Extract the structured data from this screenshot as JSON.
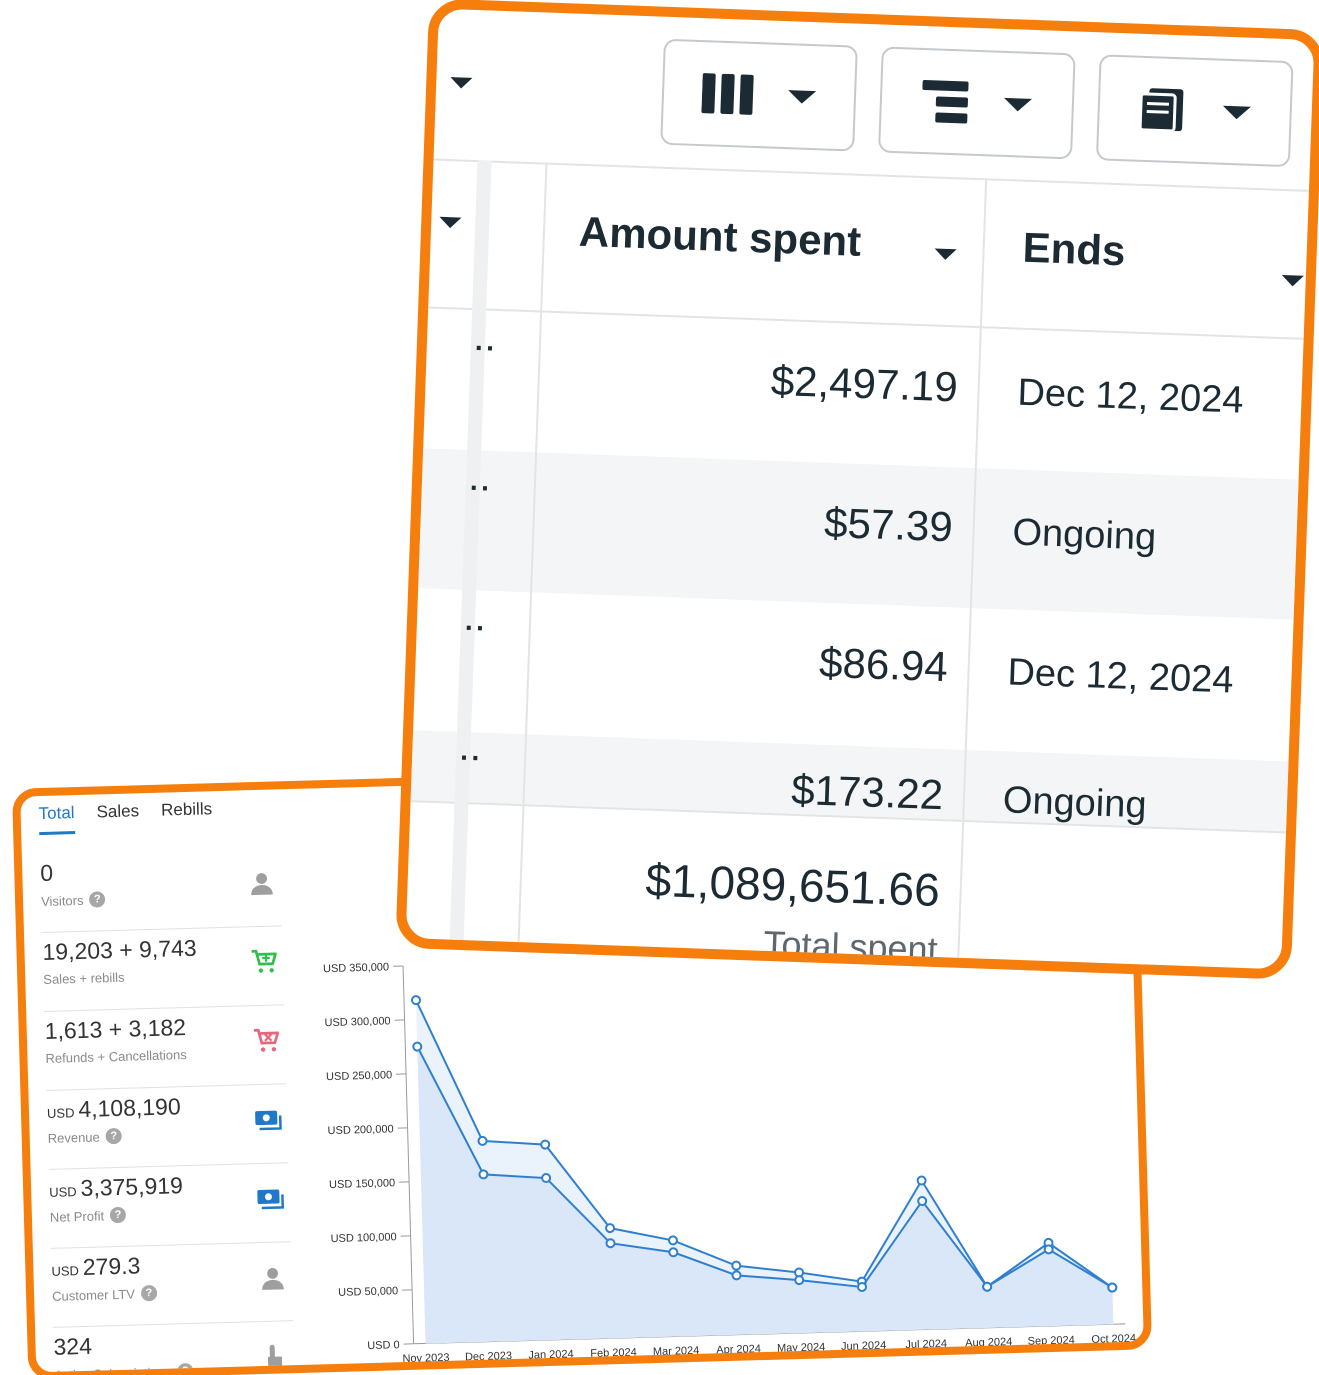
{
  "dashboard": {
    "tabs": [
      {
        "label": "Total",
        "active": true
      },
      {
        "label": "Sales",
        "active": false
      },
      {
        "label": "Rebills",
        "active": false
      }
    ],
    "stats": [
      {
        "value": "0",
        "unit": "",
        "label": "Visitors",
        "help": true,
        "icon": "user-icon",
        "icon_color": "#9e9e9e"
      },
      {
        "value": "19,203 + 9,743",
        "unit": "",
        "label": "Sales + rebills",
        "help": false,
        "icon": "cart-add-icon",
        "icon_color": "#2fbf4a"
      },
      {
        "value": "1,613 + 3,182",
        "unit": "",
        "label": "Refunds + Cancellations",
        "help": false,
        "icon": "cart-remove-icon",
        "icon_color": "#e8667a"
      },
      {
        "value": "4,108,190",
        "unit": "USD",
        "label": "Revenue",
        "help": true,
        "icon": "money-icon",
        "icon_color": "#1f78c8"
      },
      {
        "value": "3,375,919",
        "unit": "USD",
        "label": "Net Profit",
        "help": true,
        "icon": "money-icon",
        "icon_color": "#1f78c8"
      },
      {
        "value": "279.3",
        "unit": "USD",
        "label": "Customer LTV",
        "help": true,
        "icon": "user-icon",
        "icon_color": "#9e9e9e"
      },
      {
        "value": "324",
        "unit": "",
        "label": "Active Subscriptions",
        "help": true,
        "icon": "tap-icon",
        "icon_color": "#9e9e9e"
      }
    ],
    "help_glyph": "?"
  },
  "chart_data": {
    "type": "area",
    "x": [
      "Nov 2023",
      "Dec 2023",
      "Jan 2024",
      "Feb 2024",
      "Mar 2024",
      "Apr 2024",
      "May 2024",
      "Jun 2024",
      "Jul 2024",
      "Aug 2024",
      "Sep 2024",
      "Oct 2024"
    ],
    "series": [
      {
        "values": [
          318000,
          186000,
          181000,
          102000,
          89000,
          64000,
          56000,
          46000,
          138000,
          38000,
          77000,
          34000
        ],
        "color": "#2f7fd1",
        "fill": "#eaf2fb"
      },
      {
        "values": [
          275000,
          155000,
          150000,
          88000,
          78000,
          55000,
          49000,
          41000,
          119000,
          38000,
          71000,
          34000
        ],
        "color": "#2f7fd1",
        "fill": "#d9e7f8"
      }
    ],
    "yticks": [
      "USD 0",
      "USD 50,000",
      "USD 100,000",
      "USD 150,000",
      "USD 200,000",
      "USD 250,000",
      "USD 300,000",
      "USD 350,000"
    ],
    "ylim": [
      0,
      350000
    ],
    "grid": false,
    "markers": true
  },
  "ads_table": {
    "columns": [
      {
        "label": "Amount spent"
      },
      {
        "label": "Ends"
      }
    ],
    "rows": [
      {
        "amount": "$2,497.19",
        "ends": "Dec 12, 2024",
        "shaded": false
      },
      {
        "amount": "$57.39",
        "ends": "Ongoing",
        "shaded": true
      },
      {
        "amount": "$86.94",
        "ends": "Dec 12, 2024",
        "shaded": false
      },
      {
        "amount": "$173.22",
        "ends": "Ongoing",
        "shaded": true
      }
    ],
    "row_menu_glyph": "··",
    "total": {
      "value": "$1,089,651.66",
      "label": "Total spent"
    },
    "toolbar": [
      {
        "icon": "columns-icon"
      },
      {
        "icon": "breakdown-icon"
      },
      {
        "icon": "reports-icon"
      }
    ],
    "colors": {
      "accent_border": "#f57e0c",
      "text": "#1c2b33"
    }
  }
}
